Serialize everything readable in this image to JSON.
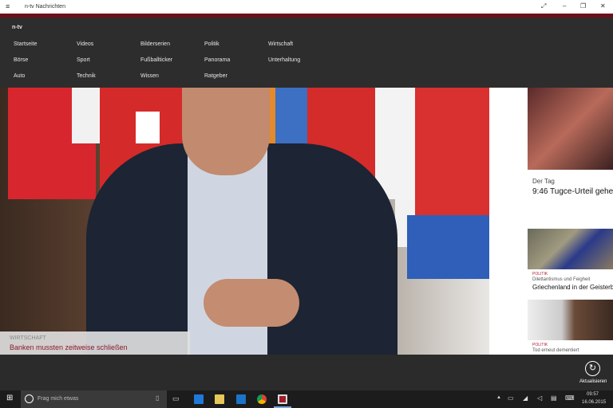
{
  "window": {
    "title": "n-tv Nachrichten"
  },
  "nav": {
    "brand": "n-tv",
    "items": [
      [
        "Startseite",
        "Videos",
        "Bilderserien",
        "Politik",
        "Wirtschaft"
      ],
      [
        "Börse",
        "Sport",
        "Fußballticker",
        "Panorama",
        "Unterhaltung"
      ],
      [
        "Auto",
        "Technik",
        "Wissen",
        "Ratgeber"
      ]
    ]
  },
  "hero": {
    "category": "WIRTSCHAFT",
    "headline": "Banken mussten zeitweise schließen"
  },
  "tiles": [
    {
      "label": "Der Tag",
      "headline": "9:46 Tugce-Urteil gehe"
    },
    {
      "category": "POLITIK",
      "subtitle": "Dilettantismus und Feigheit",
      "headline": "Griechenland in der Geisterba"
    },
    {
      "category": "POLITIK",
      "subtitle": "Tod erneut dementiert"
    }
  ],
  "appbar": {
    "refresh_label": "Aktualisieren"
  },
  "taskbar": {
    "search_placeholder": "Frag mich etwas",
    "time": "09:57",
    "date": "16.06.2015"
  },
  "colors": {
    "accent": "#6e0f1c",
    "caption_red": "#8b1a2b"
  }
}
